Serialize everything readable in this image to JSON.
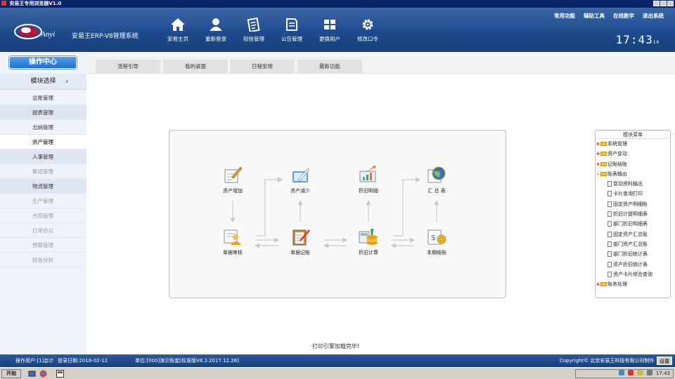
{
  "window": {
    "title": "安易王专用浏览器V1.0"
  },
  "header": {
    "system_name": "安易王ERP-V8管理系统",
    "logo_text": "Anyi",
    "nav": [
      {
        "label": "安易主页",
        "icon": "home-icon"
      },
      {
        "label": "重新登录",
        "icon": "user-icon"
      },
      {
        "label": "短信管理",
        "icon": "notepad-icon"
      },
      {
        "label": "公告管理",
        "icon": "document-icon"
      },
      {
        "label": "更换用户",
        "icon": "users-grid-icon"
      },
      {
        "label": "修改口令",
        "icon": "gear-icon"
      }
    ],
    "top_links": [
      "常用功能",
      "辅助工具",
      "在线教学",
      "退出系统"
    ],
    "clock": "17:43",
    "clock_suffix": "10"
  },
  "sidebar": {
    "title": "操作中心",
    "module_select": "模块选择",
    "module_select_arrow": "v",
    "items": [
      {
        "label": "总账管理",
        "state": "normal"
      },
      {
        "label": "报表管理",
        "state": "alt"
      },
      {
        "label": "出纳管理",
        "state": "normal"
      },
      {
        "label": "资产管理",
        "state": "active"
      },
      {
        "label": "人事管理",
        "state": "alt"
      },
      {
        "label": "集团管理",
        "state": "dim"
      },
      {
        "label": "物流管理",
        "state": "alt"
      },
      {
        "label": "生产管理",
        "state": "dim"
      },
      {
        "label": "合同管理",
        "state": "dim"
      },
      {
        "label": "日常办公",
        "state": "dim"
      },
      {
        "label": "预算管理",
        "state": "dim"
      },
      {
        "label": "财务分析",
        "state": "dim"
      }
    ]
  },
  "tabs": [
    "流程引导",
    "我的桌面",
    "日程安排",
    "最新功能"
  ],
  "flow": {
    "nodes": [
      {
        "label": "资产增加",
        "icon": "pen-paper-icon"
      },
      {
        "label": "资产减少",
        "icon": "edit-card-icon"
      },
      {
        "label": "折旧明细",
        "icon": "chart-arrow-icon"
      },
      {
        "label": "汇 总 表",
        "icon": "globe-report-icon"
      },
      {
        "label": "单据审核",
        "icon": "user-doc-icon"
      },
      {
        "label": "单据记账",
        "icon": "clipboard-pen-icon"
      },
      {
        "label": "折旧计算",
        "icon": "coins-calc-icon"
      },
      {
        "label": "本期结账",
        "icon": "coins-doc-icon"
      }
    ]
  },
  "tree": {
    "title": "模块菜单",
    "items": [
      {
        "label": "系统管理",
        "level": 0,
        "toggle": "+"
      },
      {
        "label": "资产变动",
        "level": 0,
        "toggle": "+"
      },
      {
        "label": "记账结账",
        "level": 0,
        "toggle": "+"
      },
      {
        "label": "账表输出",
        "level": 0,
        "toggle": "-"
      },
      {
        "label": "变动资料输出",
        "level": 1
      },
      {
        "label": "卡片查询打印",
        "level": 1
      },
      {
        "label": "固定资产明细账",
        "level": 1
      },
      {
        "label": "折旧计提明细表",
        "level": 1
      },
      {
        "label": "部门折旧明细表",
        "level": 1
      },
      {
        "label": "固定资产汇总账",
        "level": 1
      },
      {
        "label": "部门资产汇总账",
        "level": 1
      },
      {
        "label": "部门折旧统计表",
        "level": 1
      },
      {
        "label": "资产折旧统计表",
        "level": 1
      },
      {
        "label": "资产卡片综合查询",
        "level": 1
      },
      {
        "label": "账务处理",
        "level": 0,
        "toggle": "+"
      }
    ]
  },
  "status_message": "打印引擎加载完毕!",
  "bottom": {
    "operator": "操作用户:[1]会计",
    "login_date": "登录日期:2018-02-12",
    "unit": "单位:[000]演示账套[标准版V8.3.2017.12.28]",
    "copyright": "Copyright© 北京安易王科技有限公司制作",
    "settings_label": "设置"
  },
  "taskbar": {
    "start_label": "开始",
    "time": "17:43"
  },
  "colors": {
    "header_blue": "#1d4a8c",
    "accent_button": "#1f6fd0",
    "tree_toggle": "#dd0000"
  }
}
